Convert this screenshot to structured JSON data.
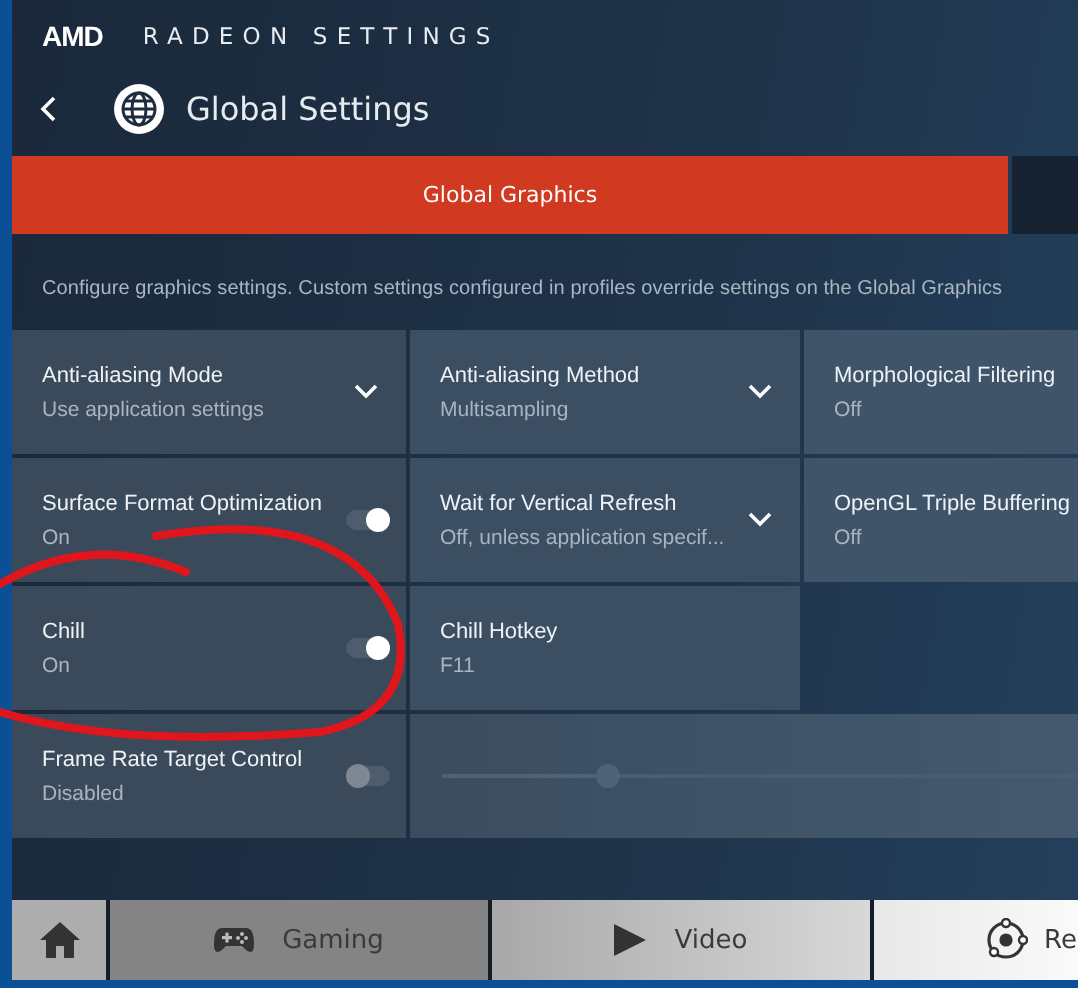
{
  "app": {
    "logo": "AMD",
    "title": "RADEON SETTINGS"
  },
  "page": {
    "title": "Global Settings"
  },
  "tabs": [
    {
      "label": "Global Graphics",
      "selected": true
    },
    {
      "selected": false
    }
  ],
  "description": "Configure graphics settings. Custom settings configured in profiles override settings on the Global Graphics",
  "settings": [
    [
      {
        "kind": "dropdown",
        "title": "Anti-aliasing Mode",
        "value": "Use application settings"
      },
      {
        "kind": "dropdown",
        "title": "Anti-aliasing Method",
        "value": "Multisampling"
      },
      {
        "kind": "info",
        "title": "Morphological Filtering",
        "value": "Off"
      }
    ],
    [
      {
        "kind": "toggle",
        "title": "Surface Format Optimization",
        "value": "On",
        "on": true,
        "disabled": false
      },
      {
        "kind": "dropdown",
        "title": "Wait for Vertical Refresh",
        "value": "Off, unless application specif..."
      },
      {
        "kind": "info",
        "title": "OpenGL Triple Buffering",
        "value": "Off"
      }
    ],
    [
      {
        "kind": "toggle",
        "title": "Chill",
        "value": "On",
        "on": true,
        "disabled": false
      },
      {
        "kind": "info",
        "title": "Chill Hotkey",
        "value": "F11"
      }
    ],
    [
      {
        "kind": "toggle",
        "title": "Frame Rate Target Control",
        "value": "Disabled",
        "on": false,
        "disabled": true
      },
      {
        "kind": "slider",
        "level": 0.26,
        "disabled": true
      }
    ]
  ],
  "bottom_nav": [
    {
      "kind": "home",
      "selected": false
    },
    {
      "kind": "gamepad",
      "label": "Gaming",
      "selected": true
    },
    {
      "kind": "play",
      "label": "Video",
      "selected": false
    },
    {
      "kind": "orbit",
      "label": "Re",
      "selected": false
    }
  ]
}
